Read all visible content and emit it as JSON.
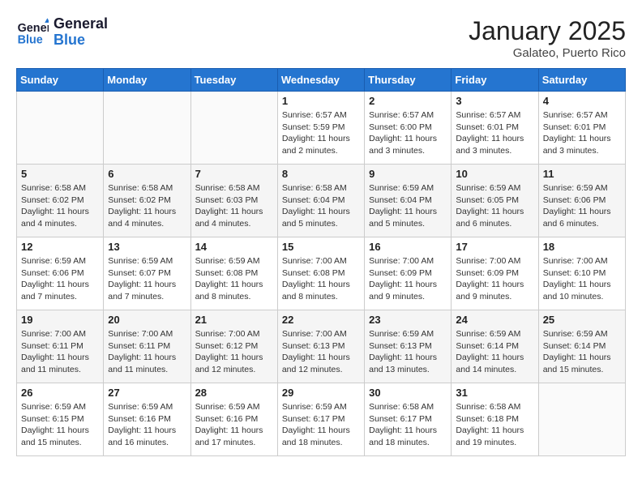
{
  "header": {
    "logo_line1": "General",
    "logo_line2": "Blue",
    "month": "January 2025",
    "location": "Galateo, Puerto Rico"
  },
  "days_of_week": [
    "Sunday",
    "Monday",
    "Tuesday",
    "Wednesday",
    "Thursday",
    "Friday",
    "Saturday"
  ],
  "weeks": [
    [
      {
        "day": "",
        "info": ""
      },
      {
        "day": "",
        "info": ""
      },
      {
        "day": "",
        "info": ""
      },
      {
        "day": "1",
        "info": "Sunrise: 6:57 AM\nSunset: 5:59 PM\nDaylight: 11 hours and 2 minutes."
      },
      {
        "day": "2",
        "info": "Sunrise: 6:57 AM\nSunset: 6:00 PM\nDaylight: 11 hours and 3 minutes."
      },
      {
        "day": "3",
        "info": "Sunrise: 6:57 AM\nSunset: 6:01 PM\nDaylight: 11 hours and 3 minutes."
      },
      {
        "day": "4",
        "info": "Sunrise: 6:57 AM\nSunset: 6:01 PM\nDaylight: 11 hours and 3 minutes."
      }
    ],
    [
      {
        "day": "5",
        "info": "Sunrise: 6:58 AM\nSunset: 6:02 PM\nDaylight: 11 hours and 4 minutes."
      },
      {
        "day": "6",
        "info": "Sunrise: 6:58 AM\nSunset: 6:02 PM\nDaylight: 11 hours and 4 minutes."
      },
      {
        "day": "7",
        "info": "Sunrise: 6:58 AM\nSunset: 6:03 PM\nDaylight: 11 hours and 4 minutes."
      },
      {
        "day": "8",
        "info": "Sunrise: 6:58 AM\nSunset: 6:04 PM\nDaylight: 11 hours and 5 minutes."
      },
      {
        "day": "9",
        "info": "Sunrise: 6:59 AM\nSunset: 6:04 PM\nDaylight: 11 hours and 5 minutes."
      },
      {
        "day": "10",
        "info": "Sunrise: 6:59 AM\nSunset: 6:05 PM\nDaylight: 11 hours and 6 minutes."
      },
      {
        "day": "11",
        "info": "Sunrise: 6:59 AM\nSunset: 6:06 PM\nDaylight: 11 hours and 6 minutes."
      }
    ],
    [
      {
        "day": "12",
        "info": "Sunrise: 6:59 AM\nSunset: 6:06 PM\nDaylight: 11 hours and 7 minutes."
      },
      {
        "day": "13",
        "info": "Sunrise: 6:59 AM\nSunset: 6:07 PM\nDaylight: 11 hours and 7 minutes."
      },
      {
        "day": "14",
        "info": "Sunrise: 6:59 AM\nSunset: 6:08 PM\nDaylight: 11 hours and 8 minutes."
      },
      {
        "day": "15",
        "info": "Sunrise: 7:00 AM\nSunset: 6:08 PM\nDaylight: 11 hours and 8 minutes."
      },
      {
        "day": "16",
        "info": "Sunrise: 7:00 AM\nSunset: 6:09 PM\nDaylight: 11 hours and 9 minutes."
      },
      {
        "day": "17",
        "info": "Sunrise: 7:00 AM\nSunset: 6:09 PM\nDaylight: 11 hours and 9 minutes."
      },
      {
        "day": "18",
        "info": "Sunrise: 7:00 AM\nSunset: 6:10 PM\nDaylight: 11 hours and 10 minutes."
      }
    ],
    [
      {
        "day": "19",
        "info": "Sunrise: 7:00 AM\nSunset: 6:11 PM\nDaylight: 11 hours and 11 minutes."
      },
      {
        "day": "20",
        "info": "Sunrise: 7:00 AM\nSunset: 6:11 PM\nDaylight: 11 hours and 11 minutes."
      },
      {
        "day": "21",
        "info": "Sunrise: 7:00 AM\nSunset: 6:12 PM\nDaylight: 11 hours and 12 minutes."
      },
      {
        "day": "22",
        "info": "Sunrise: 7:00 AM\nSunset: 6:13 PM\nDaylight: 11 hours and 12 minutes."
      },
      {
        "day": "23",
        "info": "Sunrise: 6:59 AM\nSunset: 6:13 PM\nDaylight: 11 hours and 13 minutes."
      },
      {
        "day": "24",
        "info": "Sunrise: 6:59 AM\nSunset: 6:14 PM\nDaylight: 11 hours and 14 minutes."
      },
      {
        "day": "25",
        "info": "Sunrise: 6:59 AM\nSunset: 6:14 PM\nDaylight: 11 hours and 15 minutes."
      }
    ],
    [
      {
        "day": "26",
        "info": "Sunrise: 6:59 AM\nSunset: 6:15 PM\nDaylight: 11 hours and 15 minutes."
      },
      {
        "day": "27",
        "info": "Sunrise: 6:59 AM\nSunset: 6:16 PM\nDaylight: 11 hours and 16 minutes."
      },
      {
        "day": "28",
        "info": "Sunrise: 6:59 AM\nSunset: 6:16 PM\nDaylight: 11 hours and 17 minutes."
      },
      {
        "day": "29",
        "info": "Sunrise: 6:59 AM\nSunset: 6:17 PM\nDaylight: 11 hours and 18 minutes."
      },
      {
        "day": "30",
        "info": "Sunrise: 6:58 AM\nSunset: 6:17 PM\nDaylight: 11 hours and 18 minutes."
      },
      {
        "day": "31",
        "info": "Sunrise: 6:58 AM\nSunset: 6:18 PM\nDaylight: 11 hours and 19 minutes."
      },
      {
        "day": "",
        "info": ""
      }
    ]
  ]
}
